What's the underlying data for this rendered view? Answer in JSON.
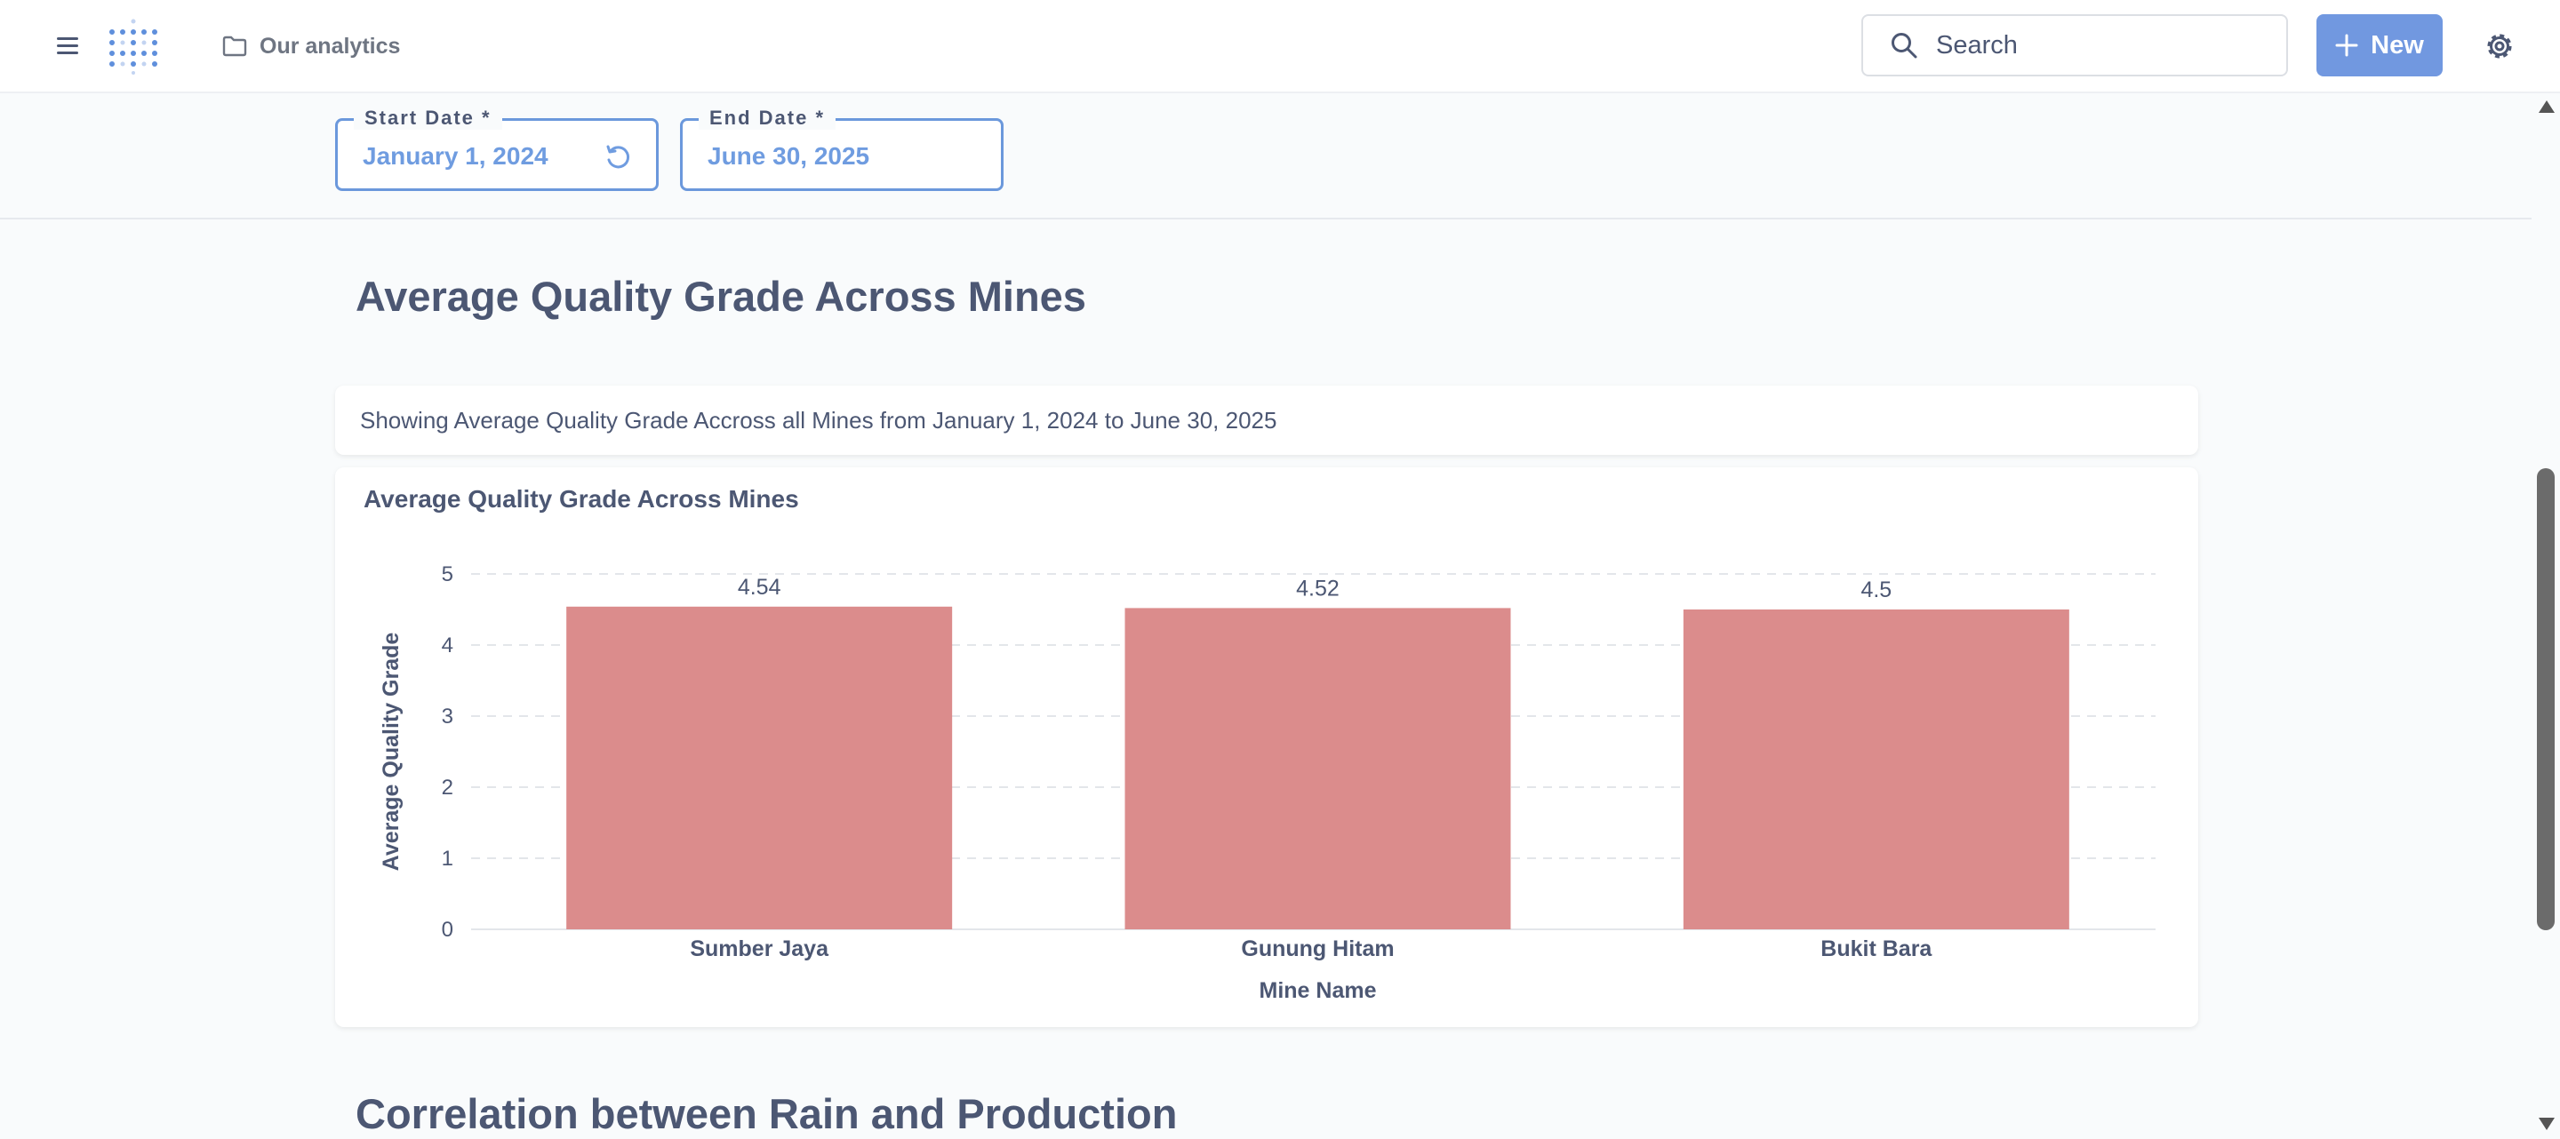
{
  "header": {
    "collection_label": "Our analytics",
    "search_label": "Search",
    "new_label": "New",
    "icons": [
      "menu-icon",
      "logo-icon",
      "folder-icon",
      "search-icon",
      "plus-icon",
      "gear-icon"
    ],
    "accent_color": "#7198e0"
  },
  "filters": {
    "start_date": {
      "label": "Start Date *",
      "value": "January 1, 2024"
    },
    "end_date": {
      "label": "End Date *",
      "value": "June 30, 2025"
    }
  },
  "main": {
    "section_title": "Average Quality Grade Across Mines",
    "text_card": "Showing Average Quality Grade Accross all Mines from January 1, 2024 to June 30, 2025",
    "chart_card_title": "Average Quality Grade Across Mines",
    "next_section_title": "Correlation between Rain and Production"
  },
  "chart_data": {
    "type": "bar",
    "title": "Average Quality Grade Across Mines",
    "categories": [
      "Sumber Jaya",
      "Gunung Hitam",
      "Bukit Bara"
    ],
    "values": [
      4.54,
      4.52,
      4.5
    ],
    "data_labels": [
      "4.54",
      "4.52",
      "4.5"
    ],
    "xlabel": "Mine Name",
    "ylabel": "Average Quality Grade",
    "ylim": [
      0,
      5
    ],
    "yticks": [
      "0",
      "1",
      "2",
      "3",
      "4",
      "5"
    ],
    "grid": true,
    "bar_color": "#db8c8c"
  }
}
